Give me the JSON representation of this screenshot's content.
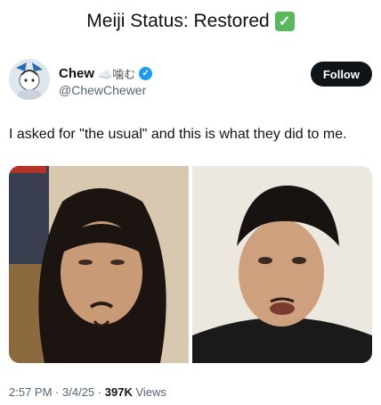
{
  "caption": {
    "text": "Meiji Status: Restored",
    "emoji_icon": "check-mark-button-icon"
  },
  "tweet": {
    "display_name": "Chew",
    "name_suffix": "☁️噛む",
    "handle": "@ChewChewer",
    "follow_label": "Follow",
    "text": "I asked for \"the usual\" and this is what they did to me.",
    "time": "2:57 PM",
    "date": "3/4/25",
    "sep": "·",
    "views_count": "397K",
    "views_label": "Views"
  },
  "colors": {
    "verified": "#1d9bf0",
    "follow_bg": "#0f1419",
    "check_green": "#5cb85c"
  }
}
